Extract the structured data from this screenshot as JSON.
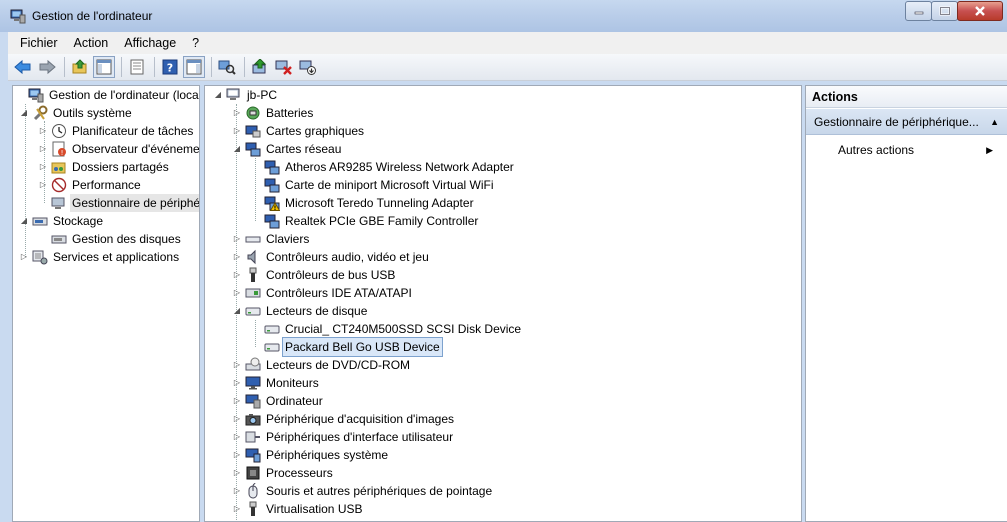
{
  "window": {
    "title": "Gestion de l'ordinateur"
  },
  "menu": [
    "Fichier",
    "Action",
    "Affichage",
    "?"
  ],
  "toolbar": {
    "buttons": [
      "back-arrow-icon",
      "forward-arrow-icon",
      "up-folder-icon",
      "show-hide-tree-icon",
      "properties-icon",
      "help-icon",
      "show-hide-action-pane-icon",
      "scan-hardware-icon",
      "update-driver-icon",
      "uninstall-device-icon",
      "disable-device-icon"
    ]
  },
  "left_tree": {
    "root": "Gestion de l'ordinateur (local)",
    "outils": "Outils système",
    "planificateur": "Planificateur de tâches",
    "observateur": "Observateur d'événements",
    "dossiers": "Dossiers partagés",
    "performance": "Performance",
    "gestionnaire": "Gestionnaire de périphériques",
    "stockage": "Stockage",
    "gestion_disques": "Gestion des disques",
    "services": "Services et applications"
  },
  "device_tree": {
    "computer": "jb-PC",
    "batteries": "Batteries",
    "cartes_graphiques": "Cartes graphiques",
    "cartes_reseau": "Cartes réseau",
    "net1": "Atheros AR9285 Wireless Network Adapter",
    "net2": "Carte de miniport Microsoft Virtual WiFi",
    "net3": "Microsoft Teredo Tunneling Adapter",
    "net4": "Realtek PCIe GBE Family Controller",
    "claviers": "Claviers",
    "audio": "Contrôleurs audio, vidéo et jeu",
    "usb": "Contrôleurs de bus USB",
    "ide": "Contrôleurs IDE ATA/ATAPI",
    "lecteurs_disque": "Lecteurs de disque",
    "disk1": "Crucial_ CT240M500SSD SCSI Disk Device",
    "disk2": "Packard Bell Go USB Device",
    "dvd": "Lecteurs de DVD/CD-ROM",
    "moniteurs": "Moniteurs",
    "ordinateur": "Ordinateur",
    "acquisition": "Périphérique d'acquisition d'images",
    "interface": "Périphériques d'interface utilisateur",
    "systeme": "Périphériques système",
    "processeurs": "Processeurs",
    "souris": "Souris et autres périphériques de pointage",
    "virtualisation": "Virtualisation USB"
  },
  "actions": {
    "header": "Actions",
    "section": "Gestionnaire de périphérique...",
    "autres": "Autres actions"
  },
  "colors": {
    "selection": "#d9e7f8",
    "titlebar": "#b9cde9",
    "pane_border": "#a0a9b6"
  }
}
